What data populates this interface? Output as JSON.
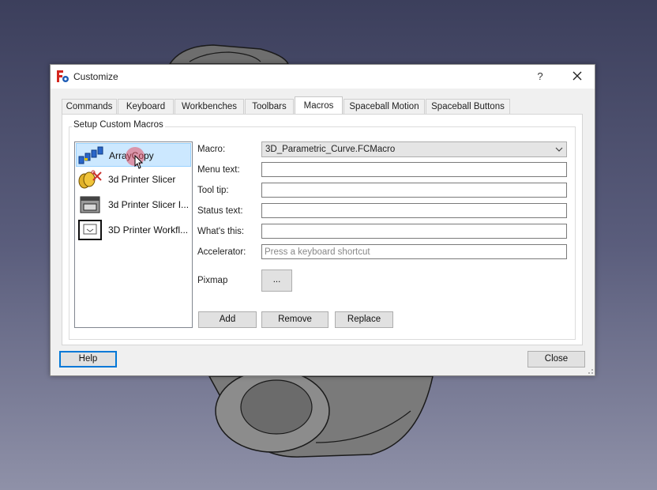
{
  "window": {
    "title": "Customize",
    "help_glyph": "?"
  },
  "tabs": [
    {
      "label": "Commands"
    },
    {
      "label": "Keyboard"
    },
    {
      "label": "Workbenches"
    },
    {
      "label": "Toolbars"
    },
    {
      "label": "Macros",
      "active": true
    },
    {
      "label": "Spaceball Motion"
    },
    {
      "label": "Spaceball Buttons"
    }
  ],
  "group": {
    "label": "Setup Custom Macros"
  },
  "macro_list": [
    {
      "label": "ArrayCopy",
      "icon": "array-copy-icon",
      "selected": true
    },
    {
      "label": "3d Printer Slicer",
      "icon": "slicer-icon"
    },
    {
      "label": "3d Printer Slicer I...",
      "icon": "slicer-box-icon"
    },
    {
      "label": "3D Printer Workfl...",
      "icon": "printer-workflow-icon"
    }
  ],
  "fields": {
    "macro_label": "Macro:",
    "macro_value": "3D_Parametric_Curve.FCMacro",
    "menu_text_label": "Menu text:",
    "tool_tip_label": "Tool tip:",
    "status_text_label": "Status text:",
    "whats_this_label": "What's this:",
    "accelerator_label": "Accelerator:",
    "accelerator_placeholder": "Press a keyboard shortcut",
    "pixmap_label": "Pixmap",
    "pixmap_button": "..."
  },
  "actions": {
    "add": "Add",
    "remove": "Remove",
    "replace": "Replace"
  },
  "footer": {
    "help": "Help",
    "close": "Close"
  },
  "colors": {
    "selection": "#cce8ff",
    "focus_border": "#0078d7",
    "background_top": "#3c3f5c"
  }
}
